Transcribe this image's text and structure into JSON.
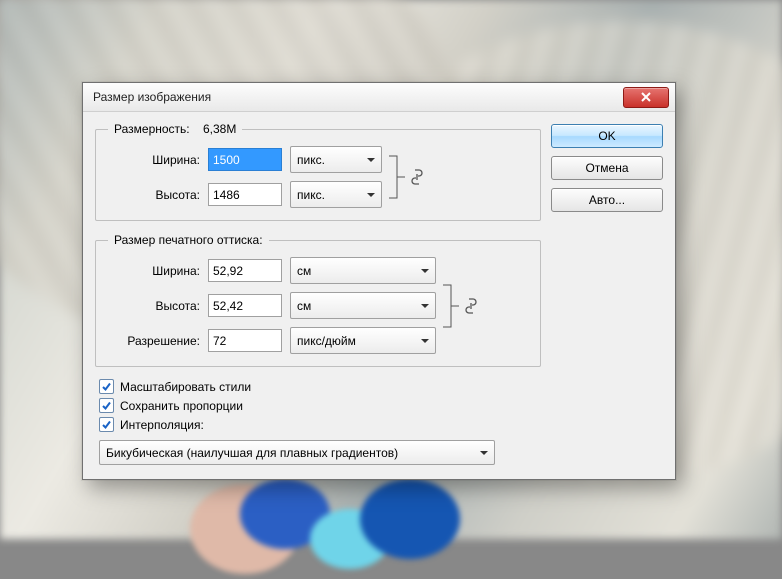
{
  "window": {
    "title": "Размер изображения"
  },
  "buttons": {
    "ok": "OK",
    "cancel": "Отмена",
    "auto": "Авто..."
  },
  "pixel_dims": {
    "legend": "Размерность:",
    "size_label": "6,38M",
    "width_label": "Ширина:",
    "width_value": "1500",
    "width_unit": "пикс.",
    "height_label": "Высота:",
    "height_value": "1486",
    "height_unit": "пикс."
  },
  "print_dims": {
    "legend": "Размер печатного оттиска:",
    "width_label": "Ширина:",
    "width_value": "52,92",
    "width_unit": "см",
    "height_label": "Высота:",
    "height_value": "52,42",
    "height_unit": "см",
    "res_label": "Разрешение:",
    "res_value": "72",
    "res_unit": "пикс/дюйм"
  },
  "checks": {
    "scale_styles": "Масштабировать стили",
    "constrain": "Сохранить пропорции",
    "resample": "Интерполяция:"
  },
  "interp": {
    "selected": "Бикубическая (наилучшая для плавных градиентов)"
  }
}
